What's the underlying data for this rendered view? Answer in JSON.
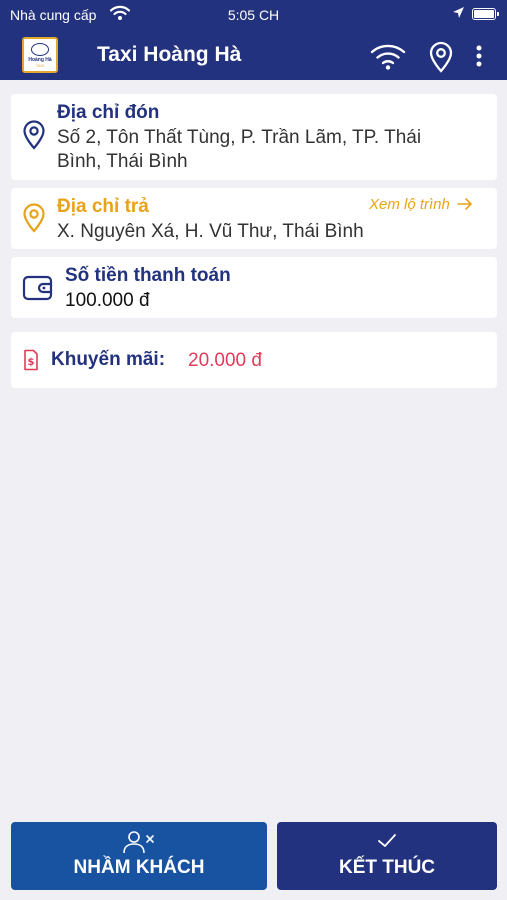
{
  "status_bar": {
    "carrier": "Nhà cung cấp",
    "time": "5:05 CH"
  },
  "header": {
    "title": "Taxi Hoàng Hà",
    "logo_text": "Hoàng Hà",
    "logo_subtext": "TAXI"
  },
  "pickup": {
    "title": "Địa chỉ đón",
    "address_line1": "Số 2, Tôn Thất Tùng, P. Trần Lãm, TP. Thái",
    "address_line2": "Bình, Thái Bình"
  },
  "dropoff": {
    "title": "Địa chỉ trả",
    "route_link": "Xem lộ trình",
    "address": "X. Nguyên Xá, H. Vũ Thư, Thái Bình"
  },
  "payment": {
    "title": "Số tiền thanh toán",
    "amount": "100.000 đ"
  },
  "promo": {
    "label": "Khuyến mãi:",
    "value": "20.000 đ"
  },
  "actions": {
    "wrong_customer": "NHẦM KHÁCH",
    "finish": "KẾT THÚC"
  },
  "colors": {
    "primary": "#23327e",
    "secondary_button": "#1853a2",
    "accent_orange": "#e8a319",
    "promo_red": "#e03c5a",
    "background": "#efeff4"
  },
  "icons": {
    "status_wifi": "wifi-icon",
    "status_location": "location-arrow-icon",
    "battery": "battery-icon",
    "nav_wifi": "wifi-icon",
    "nav_location": "map-pin-icon",
    "nav_menu": "more-vertical-icon",
    "pickup": "map-pin-icon",
    "dropoff": "map-pin-icon",
    "payment": "wallet-icon",
    "promo": "receipt-dollar-icon",
    "wrong_customer": "user-x-icon",
    "finish": "check-icon",
    "route_arrow": "arrow-right-icon"
  }
}
